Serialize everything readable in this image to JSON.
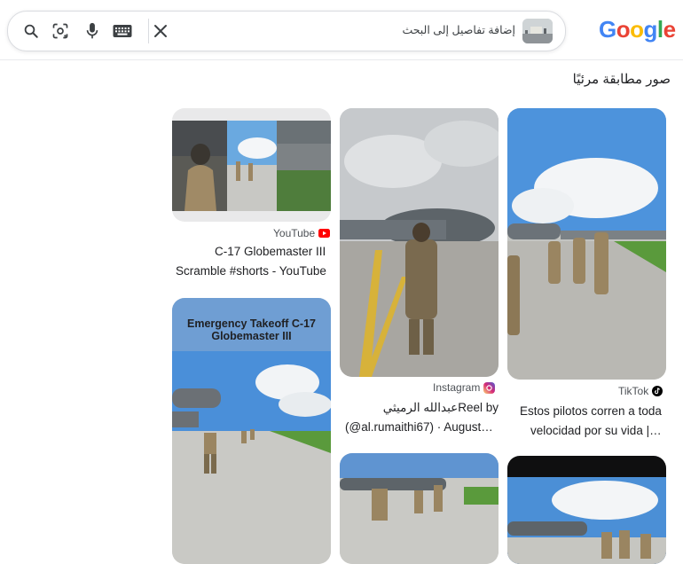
{
  "header": {
    "logo_text": "Google",
    "search": {
      "query_text": "إضافة تفاصيل إلى البحث",
      "thumb_icon": "query-image-icon",
      "buttons": [
        "search-icon",
        "lens-icon",
        "mic-icon",
        "keyboard-icon",
        "close-icon"
      ]
    }
  },
  "section": {
    "title": "صور مطابقة مرئيًا"
  },
  "results": [
    {
      "source": "YouTube",
      "source_icon": "youtube-icon",
      "title_line1": "C-17 Globemaster III",
      "title_line2": "Scramble #shorts - YouTube"
    },
    {
      "source": "Instagram",
      "source_icon": "instagram-icon",
      "title_line1": "Reel byعبدالله الرميثي",
      "title_line2": "(@al.rumaithi67) · August…"
    },
    {
      "source": "TikTok",
      "source_icon": "tiktok-icon",
      "title_line1": "Estos pilotos corren a toda",
      "title_line2": "velocidad por su vida |…"
    },
    {
      "overlay_text": "Emergency Takeoff C-17 Globemaster III"
    }
  ],
  "colors": {
    "google_blue": "#4285F4",
    "google_red": "#EA4335",
    "google_yellow": "#FBBC05",
    "google_green": "#34A853",
    "youtube_red": "#FF0000"
  }
}
